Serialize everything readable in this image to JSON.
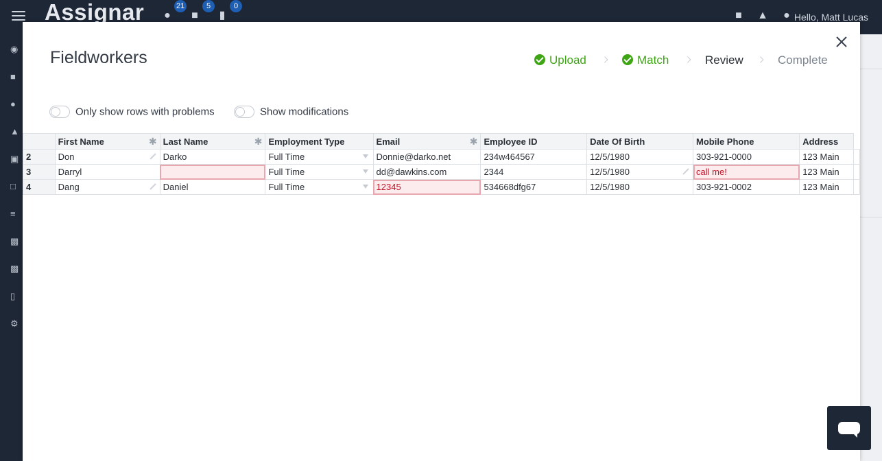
{
  "app": {
    "logo": "Assignar",
    "badges": {
      "people": "21",
      "equipment": "5",
      "jobs": "0"
    },
    "greeting": "Hello, Matt Lucas"
  },
  "modal": {
    "title": "Fieldworkers",
    "steps": [
      {
        "label": "Upload",
        "state": "done"
      },
      {
        "label": "Match",
        "state": "done"
      },
      {
        "label": "Review",
        "state": "active"
      },
      {
        "label": "Complete",
        "state": "pending"
      }
    ],
    "toggles": {
      "problems": "Only show rows with problems",
      "modifications": "Show modifications"
    }
  },
  "grid": {
    "columns": [
      "First Name",
      "Last Name",
      "Employment Type",
      "Email",
      "Employee ID",
      "Date Of Birth",
      "Mobile Phone",
      "Address"
    ],
    "rows": [
      {
        "num": "2",
        "first": "Don",
        "last": "Darko",
        "type": "Full Time",
        "email": "Donnie@darko.net",
        "id": "234w464567",
        "dob": "12/5/1980",
        "phone": "303-921-0000",
        "address": "123 Main"
      },
      {
        "num": "3",
        "first": "Darryl",
        "last": "",
        "type": "Full Time",
        "email": "dd@dawkins.com",
        "id": "2344",
        "dob": "12/5/1980",
        "phone": "call me!",
        "address": "123 Main"
      },
      {
        "num": "4",
        "first": "Dang",
        "last": "Daniel",
        "type": "Full Time",
        "email": "12345",
        "id": "534668dfg67",
        "dob": "12/5/1980",
        "phone": "303-921-0002",
        "address": "123 Main"
      }
    ]
  },
  "colors": {
    "success": "#3ea515",
    "error": "#c4162a",
    "nav": "#1e2736"
  }
}
